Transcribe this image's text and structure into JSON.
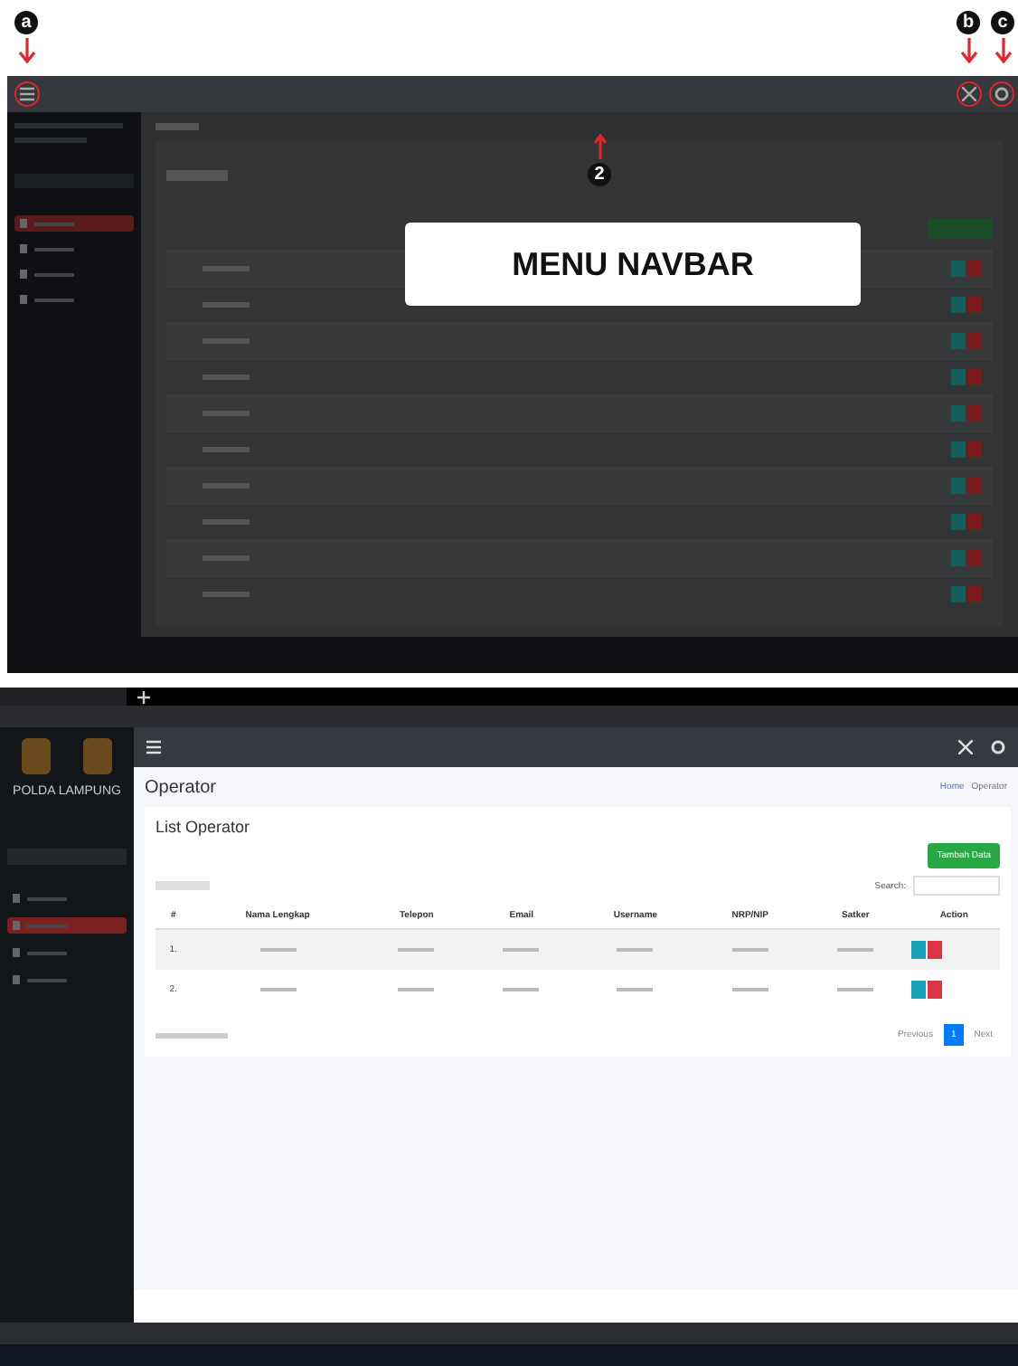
{
  "markers": [
    {
      "label": "a"
    },
    {
      "label": "b"
    },
    {
      "label": "c"
    }
  ],
  "top_screenshot": {
    "callout": "2",
    "overlay_title": "MENU NAVBAR",
    "sidebar_items": [
      {
        "selected": true
      },
      {
        "selected": false
      },
      {
        "selected": false
      },
      {
        "selected": false
      }
    ]
  },
  "bottom_screenshot": {
    "brand": "POLDA LAMPUNG",
    "page_title": "Operator",
    "breadcrumb": [
      "Home",
      "Operator"
    ],
    "card_title": "List Operator",
    "add_button": "Tambah Data",
    "search_label": "Search:",
    "sidebar_items": [
      {
        "selected": false
      },
      {
        "selected": true
      },
      {
        "selected": false
      },
      {
        "selected": false
      }
    ],
    "columns": [
      "#",
      "Nama Lengkap",
      "Telepon",
      "Email",
      "Username",
      "NRP/NIP",
      "Satker",
      "Action"
    ],
    "rows": [
      {
        "no": "1."
      },
      {
        "no": "2."
      }
    ],
    "pagination": [
      {
        "label": "Previous",
        "selected": false
      },
      {
        "label": "1",
        "selected": true
      },
      {
        "label": "Next",
        "selected": false
      }
    ]
  }
}
